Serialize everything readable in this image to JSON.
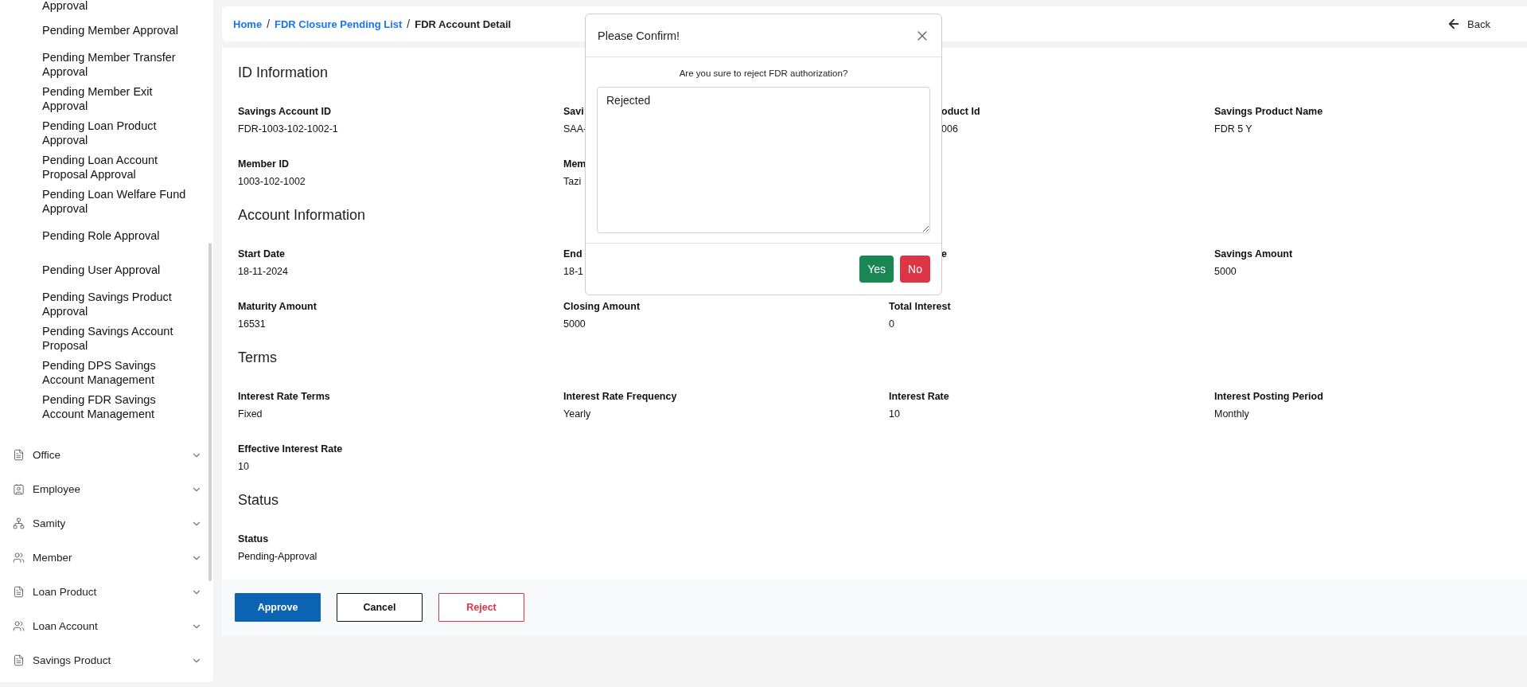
{
  "sidebar": {
    "submenu_items": [
      "Approval",
      "Pending Member Approval",
      "Pending Member Transfer Approval",
      "Pending Member Exit Approval",
      "Pending Loan Product Approval",
      "Pending Loan Account Proposal Approval",
      "Pending Loan Welfare Fund Approval",
      "Pending Role Approval",
      "Pending User Approval",
      "Pending Savings Product Approval",
      "Pending Savings Account Proposal",
      "Pending DPS Savings Account Management",
      "Pending FDR Savings Account Management"
    ],
    "menu": [
      {
        "label": "Office"
      },
      {
        "label": "Employee"
      },
      {
        "label": "Samity"
      },
      {
        "label": "Member"
      },
      {
        "label": "Loan Product"
      },
      {
        "label": "Loan Account"
      },
      {
        "label": "Savings Product"
      }
    ]
  },
  "breadcrumb_separator": "/",
  "breadcrumb": [
    {
      "label": "Home",
      "kind": "link"
    },
    {
      "label": "FDR Closure Pending List",
      "kind": "link"
    },
    {
      "label": "FDR Account Detail",
      "kind": "current"
    }
  ],
  "back_button": {
    "label": "Back"
  },
  "sections": [
    {
      "title": "ID Information",
      "fields": [
        {
          "label": "Savings Account ID",
          "value": "FDR-1003-102-1002-1",
          "kind": "full"
        },
        {
          "label": "Savi",
          "value": "SAA-",
          "kind": "full"
        },
        {
          "label": "oduct Id",
          "value": "006",
          "kind": "clipped"
        },
        {
          "label": "Savings Product Name",
          "value": "FDR 5 Y",
          "kind": "full"
        },
        {
          "label": "Member ID",
          "value": "1003-102-1002",
          "kind": "full"
        },
        {
          "label": "Mem",
          "value": "Tazi",
          "kind": "full"
        }
      ]
    },
    {
      "title": "Account Information",
      "fields": [
        {
          "label": "Start Date",
          "value": "18-11-2024"
        },
        {
          "label": "End",
          "value": "18-1"
        },
        {
          "label": "e",
          "kind": "clipped"
        },
        {
          "label": "Savings Amount",
          "value": "5000"
        },
        {
          "label": "Maturity Amount",
          "value": "16531"
        },
        {
          "label": "Closing Amount",
          "value": "5000"
        },
        {
          "label": "Total Interest",
          "value": "0"
        }
      ]
    },
    {
      "title": "Terms",
      "fields": [
        {
          "label": "Interest Rate Terms",
          "value": "Fixed"
        },
        {
          "label": "Interest Rate Frequency",
          "value": "Yearly"
        },
        {
          "label": "Interest Rate",
          "value": "10"
        },
        {
          "label": "Interest Posting Period",
          "value": "Monthly"
        },
        {
          "label": "Effective Interest Rate",
          "value": "10"
        }
      ]
    },
    {
      "title": "Status",
      "fields": [
        {
          "label": "Status",
          "value": "Pending-Approval"
        }
      ]
    }
  ],
  "actions": [
    {
      "label": "Approve",
      "kind": "primary"
    },
    {
      "label": "Cancel",
      "kind": "outline"
    },
    {
      "label": "Reject",
      "kind": "danger"
    }
  ],
  "modal": {
    "title": "Please Confirm!",
    "message": "Are you sure to reject FDR authorization?",
    "reason": "Rejected",
    "buttons": [
      {
        "label": "Yes",
        "kind": "confirm"
      },
      {
        "label": "No",
        "kind": "cancel"
      }
    ]
  }
}
